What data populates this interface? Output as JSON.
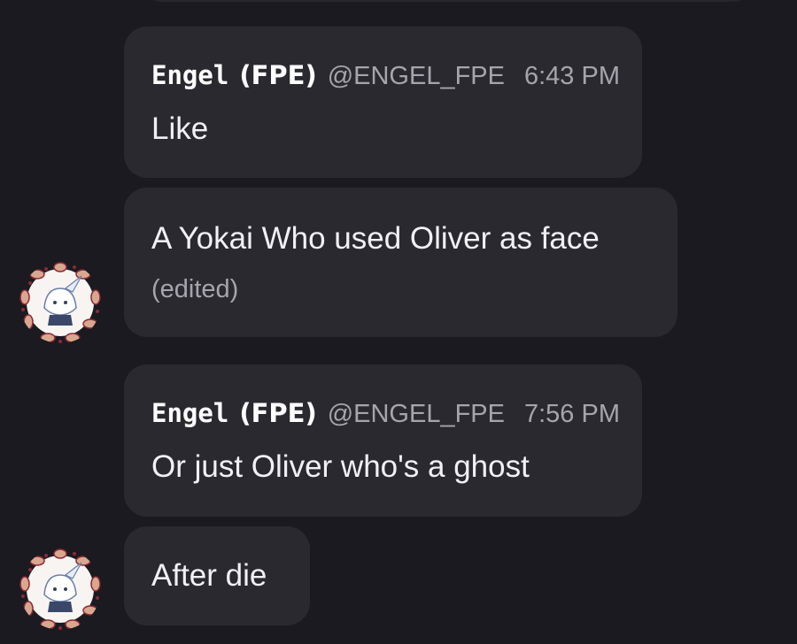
{
  "colors": {
    "background": "#1b1a21",
    "bubble": "#2a2930",
    "text": "#f1f0f5",
    "muted": "#a6a5ad"
  },
  "messages": [
    {
      "author": {
        "name": "Engel",
        "tag": "(FPE)",
        "handle": "@ENGEL_FPE"
      },
      "time": "6:43 PM",
      "text": "Like"
    },
    {
      "text": "A Yokai Who used Oliver as face",
      "edited": "(edited)",
      "avatar": "chibi-character-avatar"
    },
    {
      "author": {
        "name": "Engel",
        "tag": "(FPE)",
        "handle": "@ENGEL_FPE"
      },
      "time": "7:56 PM",
      "text": "Or just Oliver who's a ghost"
    },
    {
      "text": "After die",
      "avatar": "chibi-character-avatar"
    }
  ]
}
